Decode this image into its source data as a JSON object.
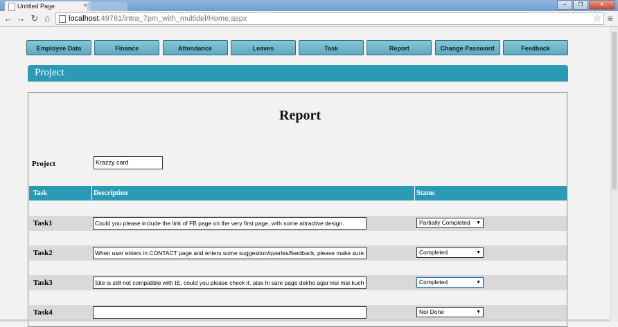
{
  "browser": {
    "tab_title": "Untitled Page",
    "url_host": "localhost",
    "url_rest": ":49761/intra_7pm_with_multidel/Home.aspx"
  },
  "nav_menu": [
    "Employee  Data",
    "Finance",
    "Attendance",
    "Leaves",
    "Task",
    "Report",
    "Change Password",
    "Feedback"
  ],
  "section_title": "Project",
  "report_title": "Report",
  "project_label": "Project",
  "project_value": "Krazzy card",
  "table": {
    "headers": [
      "Task",
      "Description",
      "Status"
    ],
    "rows": [
      {
        "task": "Task1",
        "description": "Could you please include the link of FB page on the very first page, with some attractive design.",
        "status": "Partially Completed"
      },
      {
        "task": "Task2",
        "description": "When user enters in CONTACT page and enters some suggestion/queries/feedback, please make sure t",
        "status": "Completed"
      },
      {
        "task": "Task3",
        "description": "Site is still not compatible with IE, could you please check it. aise hi sare page dekho agar kisi mai kuch",
        "status": "Completed"
      },
      {
        "task": "Task4",
        "description": "",
        "status": "Not Done"
      }
    ]
  },
  "colors": {
    "accent": "#2b9bb5",
    "nav_button": "#6fb4ca"
  }
}
